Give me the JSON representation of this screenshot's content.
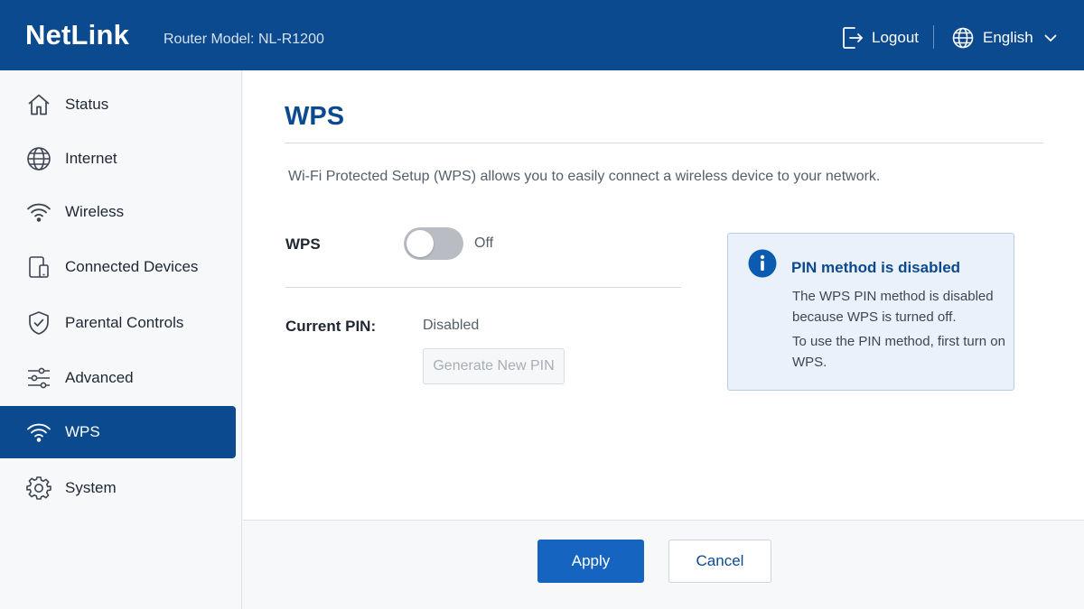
{
  "header": {
    "brand": "NetLink",
    "model": "Router Model: NL-R1200",
    "logout_label": "Logout",
    "language_label": "English"
  },
  "sidebar": {
    "items": [
      {
        "label": "Status",
        "icon": "home-icon"
      },
      {
        "label": "Internet",
        "icon": "globe-icon"
      },
      {
        "label": "Wireless",
        "icon": "wifi-icon"
      },
      {
        "label": "Connected Devices",
        "icon": "devices-icon"
      },
      {
        "label": "Parental Controls",
        "icon": "shield-check-icon"
      },
      {
        "label": "Advanced",
        "icon": "sliders-icon"
      },
      {
        "label": "WPS",
        "icon": "wifi-icon",
        "active": true
      },
      {
        "label": "System",
        "icon": "gear-icon"
      }
    ]
  },
  "main": {
    "title": "WPS",
    "description": "Wi-Fi Protected Setup (WPS) allows you to easily connect a wireless device to your network.",
    "wps_label": "WPS",
    "wps_enabled": false,
    "wps_state": "Off",
    "pin_label": "Current PIN:",
    "pin_value": "Disabled",
    "generate_button": "Generate New PIN"
  },
  "info": {
    "title": "PIN method is disabled",
    "paragraph1": "The WPS PIN method is disabled because WPS is turned off.",
    "paragraph2": "To use the PIN method, first turn on WPS."
  },
  "footer": {
    "apply_label": "Apply",
    "cancel_label": "Cancel"
  },
  "colors": {
    "brand": "#0b4a8e",
    "accent": "#1565c0",
    "toggle_off": "#b9bdc3",
    "info_bg": "#eaf1fb"
  }
}
